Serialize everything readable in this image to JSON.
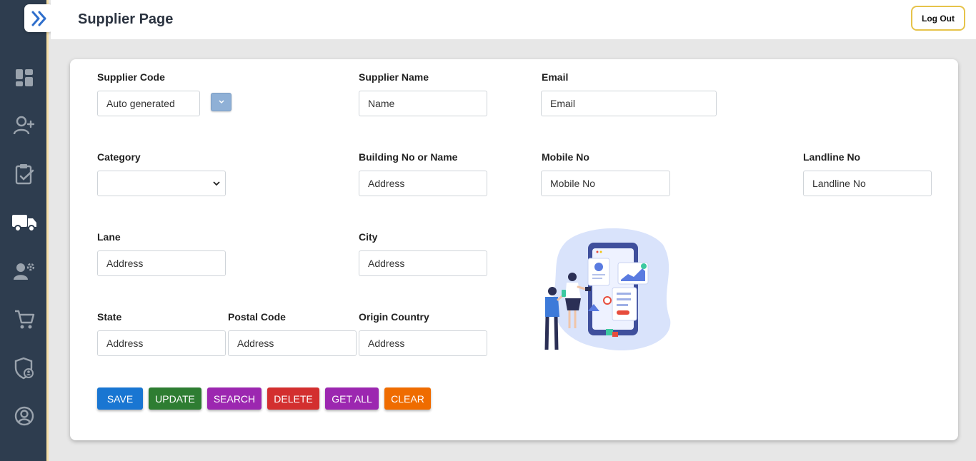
{
  "header": {
    "title": "Supplier Page",
    "logout_label": "Log Out"
  },
  "sidebar": {
    "items": [
      {
        "icon": "dashboard-icon"
      },
      {
        "icon": "add-user-icon"
      },
      {
        "icon": "clipboard-check-icon"
      },
      {
        "icon": "truck-icon",
        "active": true
      },
      {
        "icon": "user-settings-icon"
      },
      {
        "icon": "cart-icon"
      },
      {
        "icon": "shield-user-icon"
      },
      {
        "icon": "account-circle-icon"
      }
    ]
  },
  "form": {
    "supplier_code": {
      "label": "Supplier Code",
      "value": "Auto generated"
    },
    "supplier_name": {
      "label": "Supplier Name",
      "placeholder": "Name"
    },
    "email": {
      "label": "Email",
      "placeholder": "Email"
    },
    "category": {
      "label": "Category",
      "value": ""
    },
    "building": {
      "label": "Building No or Name",
      "placeholder": "Address"
    },
    "mobile": {
      "label": "Mobile No",
      "placeholder": "Mobile No"
    },
    "landline": {
      "label": "Landline No",
      "placeholder": "Landline No"
    },
    "lane": {
      "label": "Lane",
      "placeholder": "Address"
    },
    "city": {
      "label": "City",
      "placeholder": "Address"
    },
    "state": {
      "label": "State",
      "placeholder": "Address"
    },
    "postal_code": {
      "label": "Postal Code",
      "placeholder": "Address"
    },
    "origin_country": {
      "label": "Origin Country",
      "placeholder": "Address"
    }
  },
  "buttons": {
    "save": "SAVE",
    "update": "UPDATE",
    "search": "SEARCH",
    "delete": "DELETE",
    "get_all": "GET ALL",
    "clear": "CLEAR"
  },
  "colors": {
    "sidebar": "#2e3d4f",
    "save": "#1976d2",
    "update": "#2e7d32",
    "search": "#9c27b0",
    "delete": "#d32f2f",
    "get_all": "#9c27b0",
    "clear": "#ef6c00"
  }
}
